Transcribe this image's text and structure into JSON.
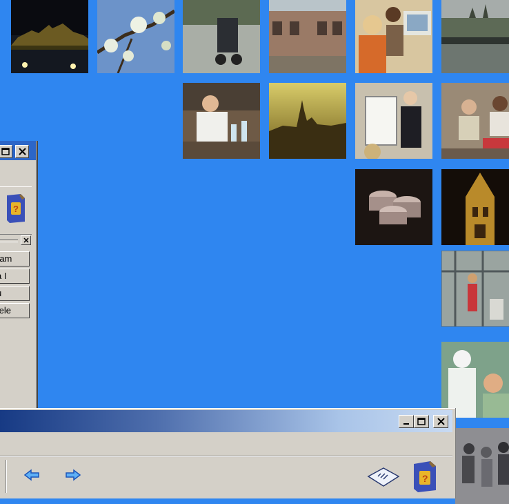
{
  "tiles": [
    {
      "name": "photo-prague-night"
    },
    {
      "name": "photo-blossom-branch"
    },
    {
      "name": "photo-stroller-street"
    },
    {
      "name": "photo-building-facade"
    },
    {
      "name": "photo-students-computer"
    },
    {
      "name": "photo-river-castle"
    },
    {
      "name": "photo-lab-chemist"
    },
    {
      "name": "photo-castle-sunset"
    },
    {
      "name": "photo-presentation-flipchart"
    },
    {
      "name": "photo-friends-sitting"
    },
    {
      "name": "photo-coins-stack"
    },
    {
      "name": "photo-powder-tower"
    },
    {
      "name": "photo-crane-workers"
    },
    {
      "name": "photo-dentist"
    },
    {
      "name": "photo-crowd-street"
    }
  ],
  "left_window": {
    "tabs": [
      "ram",
      "a I",
      "u",
      "tele"
    ]
  },
  "bottom_window": {
    "back_icon": "arrow-left",
    "forward_icon": "arrow-right"
  },
  "colors": {
    "desktop": "#2f86f0",
    "window_face": "#d4d0c8"
  }
}
